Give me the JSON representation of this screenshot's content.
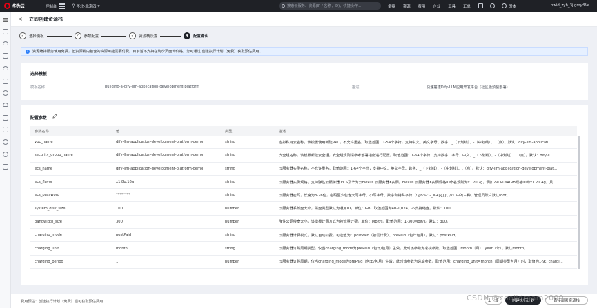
{
  "topbar": {
    "logo_text": "华为云",
    "console": "控制台",
    "region": "华北-北京四",
    "search_placeholder": "搜索云服务、资源(IP / 名称 / ID)、快捷操作...",
    "menu": [
      "备案",
      "资源",
      "费用",
      "企业",
      "工具",
      "工单"
    ],
    "language": "国体",
    "user": "hwid_zyh_3jlgmy8f-e"
  },
  "page": {
    "back": "<",
    "title": "立即创建资源栈"
  },
  "steps": [
    {
      "label": "选择模板",
      "status": "done"
    },
    {
      "label": "参数配置",
      "status": "done"
    },
    {
      "label": "资源栈设置",
      "status": "done"
    },
    {
      "label": "配置确认",
      "status": "active",
      "number": "4"
    }
  ],
  "info": {
    "text": "资源编排服务使用免费，但资源栈内包含的资源可能需要付费。目前暂不支持在询价页面询价格，您可通过 创建执行计划（免费）获取预估费用。"
  },
  "template_card": {
    "title": "选择模板",
    "name_label": "模板名称",
    "name_value": "building-a-dify-llm-application-development-platform",
    "desc_label": "描述",
    "desc_value": "快速搭建Dify-LLM应用开发平台（社区版预装部署）"
  },
  "params_card": {
    "title": "配置参数",
    "columns": [
      "参数名称",
      "值",
      "类型",
      "描述"
    ],
    "rows": [
      [
        "vpc_name",
        "dify-llm-application-development-platform-demo",
        "string",
        "虚拟私有云名称，该模板使用新建VPC，不允许重名。取值范围：1-54个字符，支持中文、英文字母、数字、_（下划线）、-（中划线）、.（点）。默认：dify-llm-applicati..."
      ],
      [
        "security_group_name",
        "dify-llm-application-development-platform-demo",
        "string",
        "安全组名称，该模板新建安全组，安全组规则请参考部署指南进行配置。取值范围：1-64个字符，支持数字、字母、中文、_（下划线）、-（中划线）、.（点）。默认：dify-ll..."
      ],
      [
        "ecs_name",
        "dify-llm-application-development-platform-demo",
        "string",
        "云服务器实例名称，不允许重名。取值范围：1-64个字符，支持中文、英文字母、数字、_（下划线）、-（中划线）、.（点）。默认：dify-llm-application-development-plat..."
      ],
      [
        "ecs_flavor",
        "x1.8u.16g",
        "string",
        "云服务器实例规格，支持弹性云服务器 ECS及华为云Flexus 云服务器X实例。Flexus 云服务器X实例规格ID命名规则为x1.?u.?g，例如2vCPUs4GiB规格ID为x1.2u.4g，具..."
      ],
      [
        "ecs_password",
        "********",
        "string",
        "云服务器密码，长度为8-26位，密码至少包含大写字母、小写字母、数字和特殊字符（!@$%^-_=+[{}]:,./?）中的三种。管理员账户默认root。"
      ],
      [
        "system_disk_size",
        "100",
        "number",
        "云服务器系统盘大小，磁盘类型默认为通用IO，单位：GB，取值范围为40-1,024，不支持缩盘。默认：100"
      ],
      [
        "bandwidth_size",
        "300",
        "number",
        "弹性公网带宽大小，该模板计费方式为按流量计费。单位：Mbit/s，取值范围：1-300Mbit/s。默认：300。"
      ],
      [
        "charging_mode",
        "postPaid",
        "string",
        "云服务器计费模式，默认自动扣费，可选值为：postPaid（按需计费）、prePaid（包年包月）。默认：postPaid。"
      ],
      [
        "charging_unit",
        "month",
        "string",
        "云服务器订购周期类型，仅当charging_mode为prePaid（包年/包月）生效，此时该参数为必填参数。取值范围：month（月）、year（年）。默认month。"
      ],
      [
        "charging_period",
        "1",
        "number",
        "云服务器订购周期，仅当charging_mode为prePaid（包年/包月）生效，此时该参数为必填参数。取值范围：charging_unit=month（周期类型为月）时，取值为1-9；chargi..."
      ]
    ]
  },
  "footer": {
    "note": "费用预估：创建执行计划（免费）后可获取预估费用",
    "prev": "上一步",
    "create_plan": "创建执行计划",
    "direct_deploy": "直接部署资源栈"
  },
  "watermark": "CSDN @coolldream2009"
}
